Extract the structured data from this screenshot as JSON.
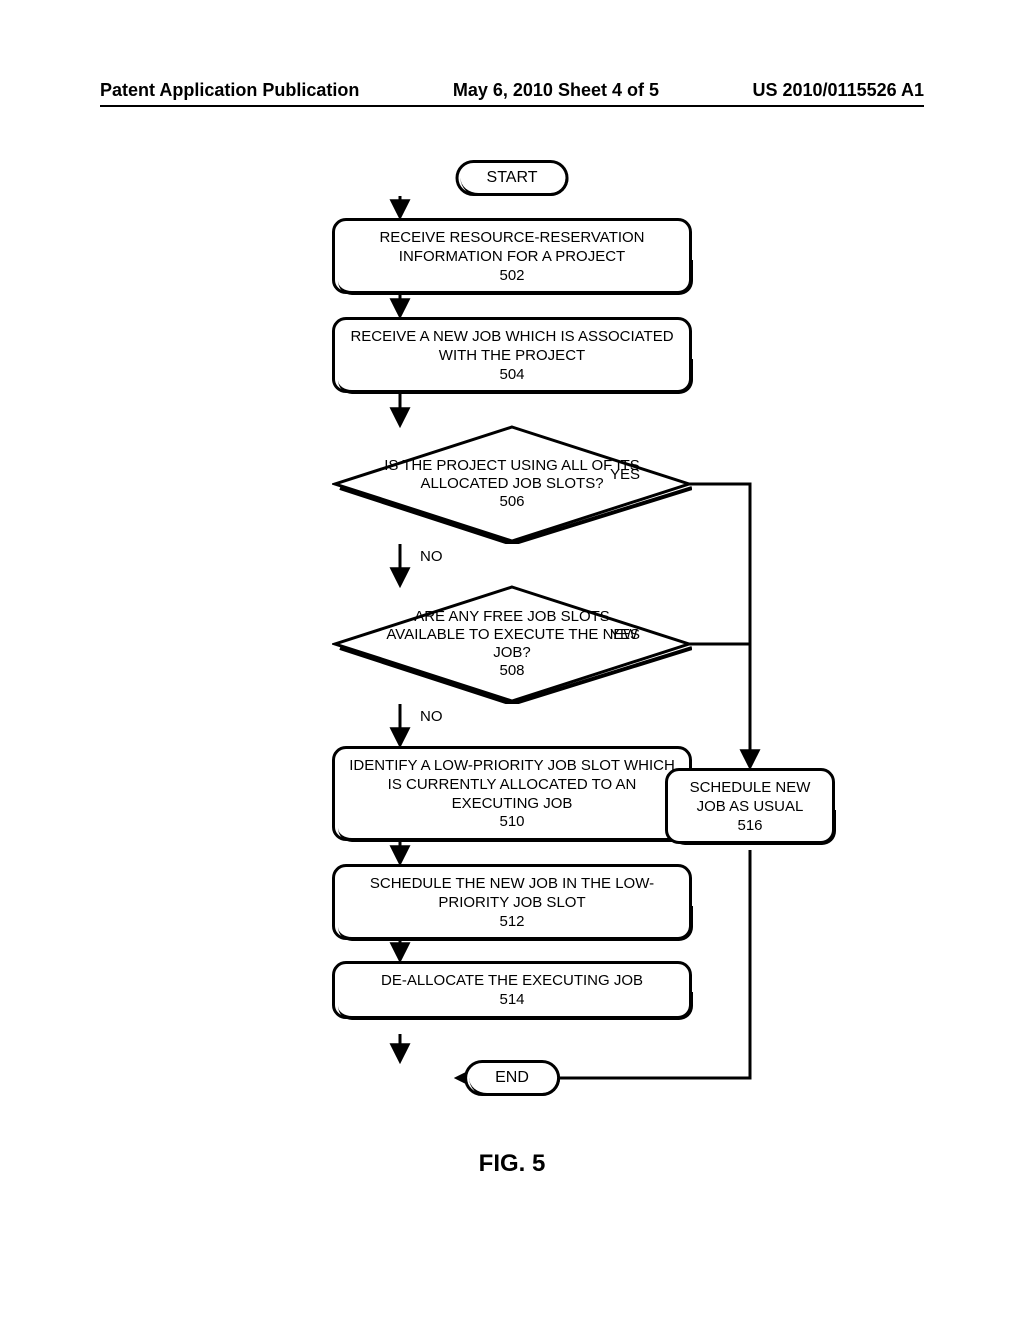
{
  "header": {
    "left": "Patent Application Publication",
    "center": "May 6, 2010  Sheet 4 of 5",
    "right": "US 2010/0115526 A1"
  },
  "flowchart": {
    "start": "START",
    "step502": {
      "text": "RECEIVE RESOURCE-RESERVATION INFORMATION FOR A PROJECT",
      "ref": "502"
    },
    "step504": {
      "text": "RECEIVE A NEW JOB WHICH IS ASSOCIATED WITH THE PROJECT",
      "ref": "504"
    },
    "dec506": {
      "text": "IS THE PROJECT USING ALL OF ITS ALLOCATED JOB SLOTS?",
      "ref": "506"
    },
    "dec508": {
      "text": "ARE ANY FREE JOB SLOTS AVAILABLE TO EXECUTE THE NEW JOB?",
      "ref": "508"
    },
    "step510": {
      "text": "IDENTIFY A LOW-PRIORITY JOB SLOT WHICH IS CURRENTLY ALLOCATED TO AN EXECUTING JOB",
      "ref": "510"
    },
    "step512": {
      "text": "SCHEDULE THE NEW JOB IN THE LOW-PRIORITY JOB SLOT",
      "ref": "512"
    },
    "step514": {
      "text": "DE-ALLOCATE THE EXECUTING JOB",
      "ref": "514"
    },
    "step516": {
      "text": "SCHEDULE NEW JOB AS USUAL",
      "ref": "516"
    },
    "end": "END",
    "labels": {
      "yes": "YES",
      "no": "NO"
    }
  },
  "figure_caption": "FIG. 5"
}
